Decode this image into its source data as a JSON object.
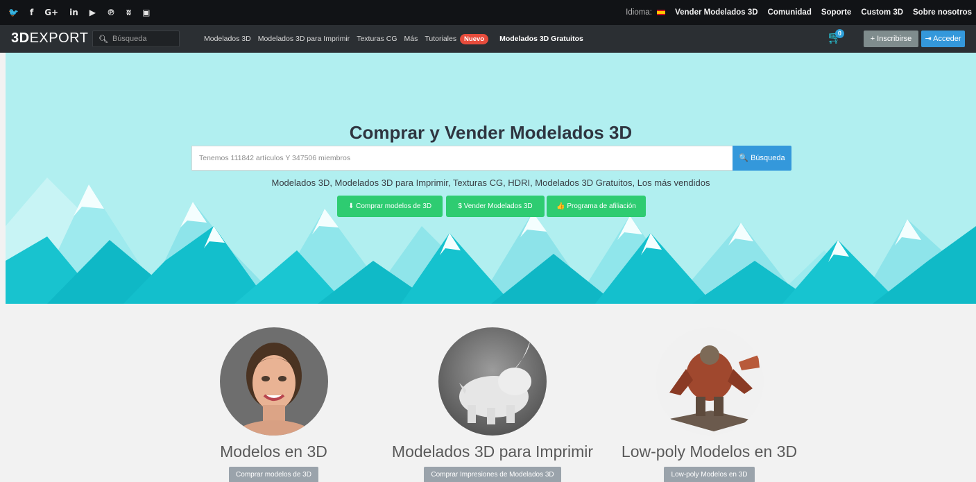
{
  "topbar": {
    "social_icons": [
      {
        "name": "twitter",
        "glyph": "🐦"
      },
      {
        "name": "facebook",
        "glyph": "f"
      },
      {
        "name": "google-plus",
        "glyph": "G+"
      },
      {
        "name": "linkedin",
        "glyph": "in"
      },
      {
        "name": "youtube",
        "glyph": "▶"
      },
      {
        "name": "pinterest",
        "glyph": "℗"
      },
      {
        "name": "vk",
        "glyph": "ʬ"
      },
      {
        "name": "instagram",
        "glyph": "▣"
      }
    ],
    "language_label": "Idioma:",
    "links": [
      "Vender Modelados 3D",
      "Comunidad",
      "Soporte",
      "Custom 3D",
      "Sobre nosotros"
    ]
  },
  "header": {
    "logo_bold": "3D",
    "logo_rest": "EXPORT",
    "search_placeholder": "Búsqueda",
    "nav": [
      "Modelados 3D",
      "Modelados 3D para Imprimir",
      "Texturas CG",
      "Más",
      "Tutoriales"
    ],
    "nav_badge": "Nuevo",
    "nav_free": "Modelados 3D Gratuitos",
    "cart_count": "0",
    "signup_label": "+ Inscribirse",
    "login_label": "⇥ Acceder"
  },
  "hero": {
    "title": "Comprar y Vender Modelados 3D",
    "search_placeholder": "Tenemos 111842 artículos Y 347506 miembros",
    "search_button": "🔍 Búsqueda",
    "subtitle": "Modelados 3D, Modelados 3D para Imprimir, Texturas CG, HDRI, Modelados 3D Gratuitos, Los más vendidos",
    "actions": [
      "⬇ Comprar modelos de 3D",
      "$ Vender Modelados 3D",
      "👍 Programa de afiliación"
    ]
  },
  "cards": [
    {
      "title": "Modelos en 3D",
      "button": "Comprar modelos de 3D"
    },
    {
      "title": "Modelados 3D para Imprimir",
      "button": "Comprar Impresiones de Modelados 3D"
    },
    {
      "title": "Low-poly Modelos en 3D",
      "button": "Low-poly Modelos en 3D"
    }
  ],
  "colors": {
    "topbar": "#111316",
    "header": "#2b2f33",
    "hero_bg": "#b1eff0",
    "mountain_teal": "#14c6d2",
    "action_green": "#2ecc71",
    "primary_blue": "#3498db",
    "badge_red": "#e74c3c"
  }
}
